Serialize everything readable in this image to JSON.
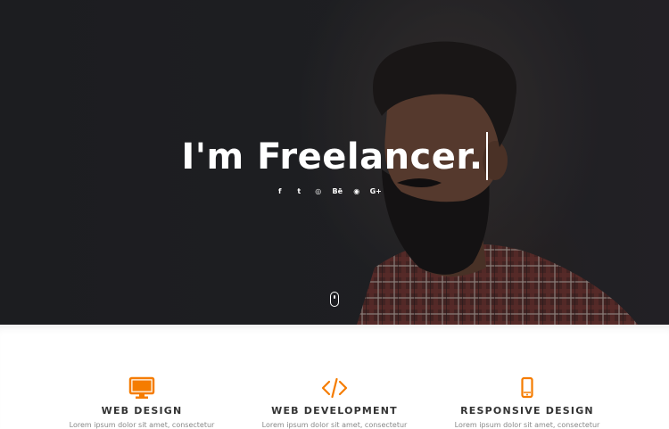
{
  "hero": {
    "title": "I'm Freelancer.",
    "socials": [
      {
        "icon": "facebook-icon",
        "glyph": "f"
      },
      {
        "icon": "twitter-icon",
        "glyph": "t"
      },
      {
        "icon": "dribbble-icon",
        "glyph": "◎"
      },
      {
        "icon": "behance-icon",
        "glyph": "Bē"
      },
      {
        "icon": "github-icon",
        "glyph": "◉"
      },
      {
        "icon": "google-plus-icon",
        "glyph": "G+"
      }
    ],
    "scroll_icon": "mouse-scroll-icon"
  },
  "services": [
    {
      "icon": "desktop-icon",
      "title": "WEB DESIGN",
      "desc": "Lorem ipsum dolor sit amet, consectetur"
    },
    {
      "icon": "code-icon",
      "title": "WEB DEVELOPMENT",
      "desc": "Lorem ipsum dolor sit amet, consectetur"
    },
    {
      "icon": "mobile-icon",
      "title": "RESPONSIVE DESIGN",
      "desc": "Lorem ipsum dolor sit amet, consectetur"
    }
  ],
  "colors": {
    "accent": "#f57c00",
    "hero_bg": "#202124",
    "heading": "#333333",
    "body_text": "#888888"
  }
}
